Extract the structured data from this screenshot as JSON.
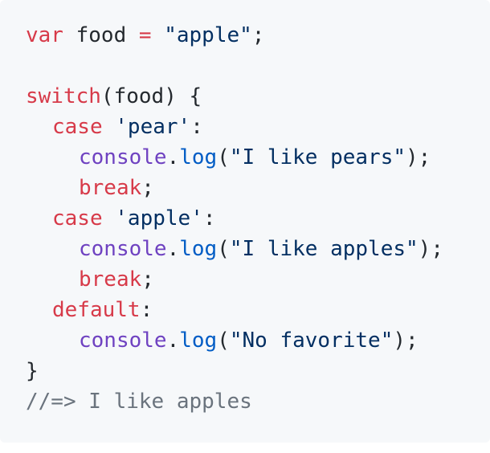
{
  "code": {
    "line1": {
      "kw_var": "var",
      "ident": " food ",
      "op": "=",
      "space": " ",
      "str": "\"apple\"",
      "end": ";"
    },
    "line3": {
      "kw_switch": "switch",
      "rest": "(food) {"
    },
    "line4": {
      "kw_case": "case",
      "space": " ",
      "str": "'pear'",
      "end": ":"
    },
    "line5": {
      "obj": "console",
      "dot": ".",
      "method": "log",
      "open": "(",
      "str": "\"I like pears\"",
      "close": ");"
    },
    "line6": {
      "kw_break": "break",
      "end": ";"
    },
    "line7": {
      "kw_case": "case",
      "space": " ",
      "str": "'apple'",
      "end": ":"
    },
    "line8": {
      "obj": "console",
      "dot": ".",
      "method": "log",
      "open": "(",
      "str": "\"I like apples\"",
      "close": ");"
    },
    "line9": {
      "kw_break": "break",
      "end": ";"
    },
    "line10": {
      "kw_default": "default",
      "end": ":"
    },
    "line11": {
      "obj": "console",
      "dot": ".",
      "method": "log",
      "open": "(",
      "str": "\"No favorite\"",
      "close": ");"
    },
    "line12": {
      "brace": "}"
    },
    "line13": {
      "comment": "//=> I like apples"
    }
  },
  "colors": {
    "background": "#f6f8fa",
    "keyword": "#d73a49",
    "string": "#032f62",
    "object": "#6f42c1",
    "method": "#005cc5",
    "comment": "#6a737d",
    "text": "#24292e"
  }
}
